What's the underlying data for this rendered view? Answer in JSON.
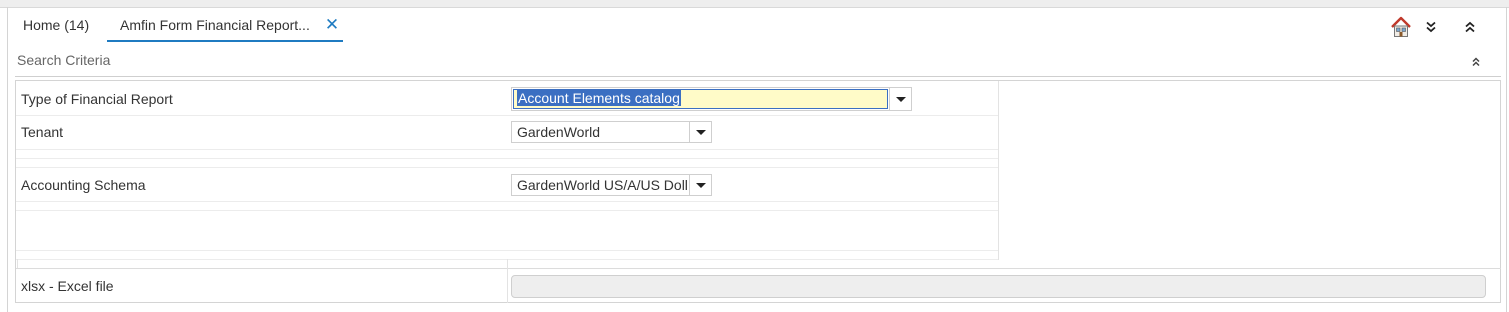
{
  "tabs": [
    {
      "label": "Home (14)"
    },
    {
      "label": "Amfin Form Financial Report..."
    }
  ],
  "toolbar": {
    "home_icon": "home-icon",
    "expand_icon": "double-chevron-down-icon",
    "collapse_icon": "double-chevron-up-icon"
  },
  "search_criteria": {
    "title": "Search Criteria",
    "fields": {
      "report_type": {
        "label": "Type of Financial Report",
        "value": "Account Elements catalog"
      },
      "tenant": {
        "label": "Tenant",
        "value": "GardenWorld"
      },
      "schema": {
        "label": "Accounting Schema",
        "value": "GardenWorld US/A/US Dollar"
      },
      "excel": {
        "label": "xlsx - Excel file",
        "value": ""
      }
    }
  },
  "colors": {
    "accent": "#1f7bc1",
    "focus_fill": "#fffbc8",
    "selection": "#3b6fc2"
  }
}
